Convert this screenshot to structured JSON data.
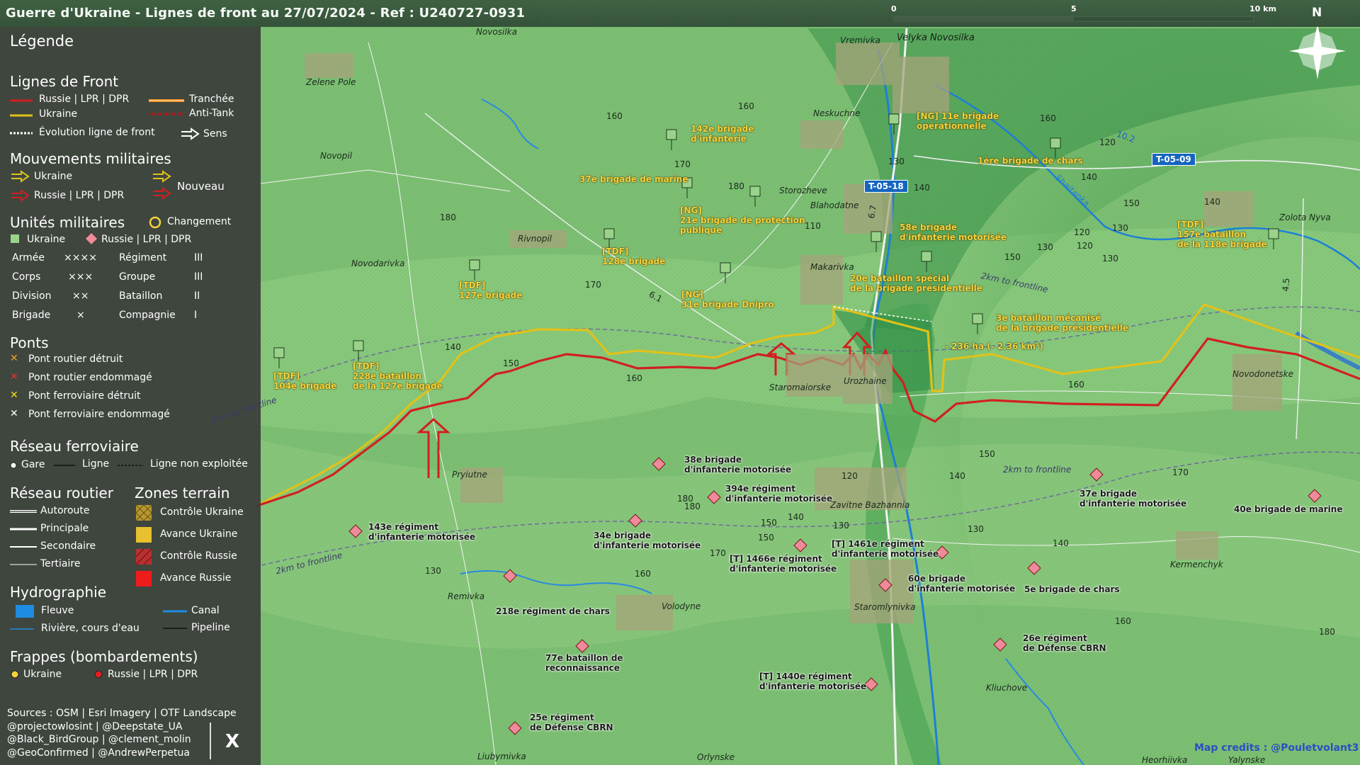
{
  "title": "Guerre d'Ukraine - Lignes de front au 27/07/2024 - Ref : U240727-0931",
  "scale": {
    "labels": [
      "0",
      "5",
      "10 km"
    ]
  },
  "compass": {
    "north": "N"
  },
  "credits": "Map credits : @Pouletvolant3",
  "area_label": "- 236 ha (- 2.36 km²)",
  "colors": {
    "russia": "#d21f1f",
    "ukraine": "#e0c21a",
    "trench": "#f08a1f",
    "river": "#1e7fd6",
    "hq_green": "#9ad28a"
  },
  "legend": {
    "title": "Légende",
    "front": {
      "heading": "Lignes de Front",
      "russia": "Russie | LPR | DPR",
      "ukraine": "Ukraine",
      "trench": "Tranchée",
      "antitank": "Anti-Tank",
      "evolution": "Évolution ligne de front",
      "sens": "Sens"
    },
    "mouvements": {
      "heading": "Mouvements militaires",
      "ukraine": "Ukraine",
      "russia": "Russie | LPR | DPR",
      "new": "Nouveau"
    },
    "unites": {
      "heading": "Unités militaires",
      "change": "Changement",
      "ukraine": "Ukraine",
      "russia": "Russie | LPR | DPR",
      "rows": [
        {
          "a": "Armée",
          "as": "××××",
          "b": "Régiment",
          "bs": "III"
        },
        {
          "a": "Corps",
          "as": "×××",
          "b": "Groupe",
          "bs": "III"
        },
        {
          "a": "Division",
          "as": "××",
          "b": "Bataillon",
          "bs": "II"
        },
        {
          "a": "Brigade",
          "as": "×",
          "b": "Compagnie",
          "bs": "I"
        }
      ]
    },
    "ponts": {
      "heading": "Ponts",
      "items": [
        "Pont routier détruit",
        "Pont routier endommagé",
        "Pont ferroviaire détruit",
        "Pont ferroviaire endommagé"
      ]
    },
    "rail": {
      "heading": "Réseau ferroviaire",
      "gare": "Gare",
      "ligne": "Ligne",
      "non": "Ligne non exploitée"
    },
    "routes": {
      "heading": "Réseau routier",
      "items": [
        "Autoroute",
        "Principale",
        "Secondaire",
        "Tertiaire"
      ]
    },
    "zones": {
      "heading": "Zones terrain",
      "items": [
        "Contrôle Ukraine",
        "Avance Ukraine",
        "Contrôle Russie",
        "Avance Russie"
      ]
    },
    "hydro": {
      "heading": "Hydrographie",
      "fleuve": "Fleuve",
      "riviere": "Rivière, cours d'eau",
      "canal": "Canal",
      "pipeline": "Pipeline"
    },
    "frappes": {
      "heading": "Frappes (bombardements)",
      "ukraine": "Ukraine",
      "russia": "Russie | LPR | DPR"
    },
    "sources": [
      "Sources : OSM | Esri Imagery | OTF Landscape",
      "@projectowlosint | @Deepstate_UA",
      "@Black_BirdGroup | @clement_molin",
      "@GeoConfirmed | @AndrewPerpetua"
    ],
    "x_logo": "X"
  },
  "places": [
    {
      "name": "Novosilka",
      "bold": false
    },
    {
      "name": "Vremivka",
      "bold": false
    },
    {
      "name": "Velyka Novosilka",
      "bold": true
    },
    {
      "name": "Zelene Pole",
      "bold": false
    },
    {
      "name": "Neskuchne",
      "bold": false
    },
    {
      "name": "Novopil",
      "bold": false
    },
    {
      "name": "Storozheve",
      "bold": false
    },
    {
      "name": "Blahodatne",
      "bold": false
    },
    {
      "name": "Rivnopil",
      "bold": false
    },
    {
      "name": "Novodarivka",
      "bold": false
    },
    {
      "name": "Makarivka",
      "bold": false
    },
    {
      "name": "Zolota Nyva",
      "bold": false
    },
    {
      "name": "Staromaiorske",
      "bold": false
    },
    {
      "name": "Urozhaine",
      "bold": false
    },
    {
      "name": "Novodonetske",
      "bold": false
    },
    {
      "name": "Pryiutne",
      "bold": false
    },
    {
      "name": "Zavitne Bazhannia",
      "bold": false
    },
    {
      "name": "Kermenchyk",
      "bold": false
    },
    {
      "name": "Remivka",
      "bold": false
    },
    {
      "name": "Volodyne",
      "bold": false
    },
    {
      "name": "Staromlynivka",
      "bold": false
    },
    {
      "name": "Kliuchove",
      "bold": false
    },
    {
      "name": "Liubymivka",
      "bold": false
    },
    {
      "name": "Orlynske",
      "bold": false
    },
    {
      "name": "Heorhiivka",
      "bold": false
    },
    {
      "name": "Yalynske",
      "bold": false
    }
  ],
  "roads": [
    "T-05-18",
    "T-05-09"
  ],
  "road_minor": [
    "6.1",
    "6.7",
    "4.5",
    "10.2"
  ],
  "rivers": [
    "Shaitanka"
  ],
  "elevations": [
    "160",
    "160",
    "170",
    "180",
    "180",
    "160",
    "120",
    "130",
    "110",
    "140",
    "120",
    "130",
    "150",
    "140",
    "130",
    "140",
    "150",
    "120",
    "130",
    "180",
    "170",
    "160",
    "140",
    "150",
    "150",
    "130",
    "140",
    "170",
    "160",
    "120",
    "140",
    "150",
    "140",
    "130",
    "180",
    "170",
    "160",
    "150",
    "160",
    "130",
    "180"
  ],
  "frontline_labels": [
    "2km to frontline",
    "2km to frontline",
    "2km to frontline",
    "2km to frontline"
  ],
  "units_ua": [
    "142e brigade\nd'infanterie",
    "[NG] 11e brigade\nopérationnelle",
    "1ère brigade de chars",
    "37e brigade de marine",
    "[NG]\n21e brigade de protection\npublique",
    "58e brigade\nd'infanterie motorisée",
    "[TDF]\n128e brigade",
    "[TDF]\n157e bataillon\nde la 118e brigade",
    "[TDF]\n127e brigade",
    "20e bataillon spécial\nde la brigade présidentielle",
    "[NG]\n31e brigade Dnipro",
    "3e bataillon mécanisé\nde la brigade présidentielle",
    "[TDF]\n104e brigade",
    "[TDF]\n228e bataillon\nde la 127e brigade"
  ],
  "units_ru": [
    "38e brigade\nd'infanterie motorisée",
    "394e régiment\nd'infanterie motorisée",
    "37e brigade\nd'infanterie motorisée",
    "40e brigade de marine",
    "143e régiment\nd'infanterie motorisée",
    "34e brigade\nd'infanterie motorisée",
    "[T] 1466e régiment\nd'infanterie motorisée",
    "[T] 1461e régiment\nd'infanterie motorisée",
    "60e brigade\nd'infanterie motorisée",
    "5e brigade de chars",
    "218e régiment de chars",
    "26e régiment\nde Défense CBRN",
    "77e bataillon de\nreconnaissance",
    "[T] 1440e régiment\nd'infanterie motorisée",
    "25e régiment\nde Défense CBRN"
  ]
}
